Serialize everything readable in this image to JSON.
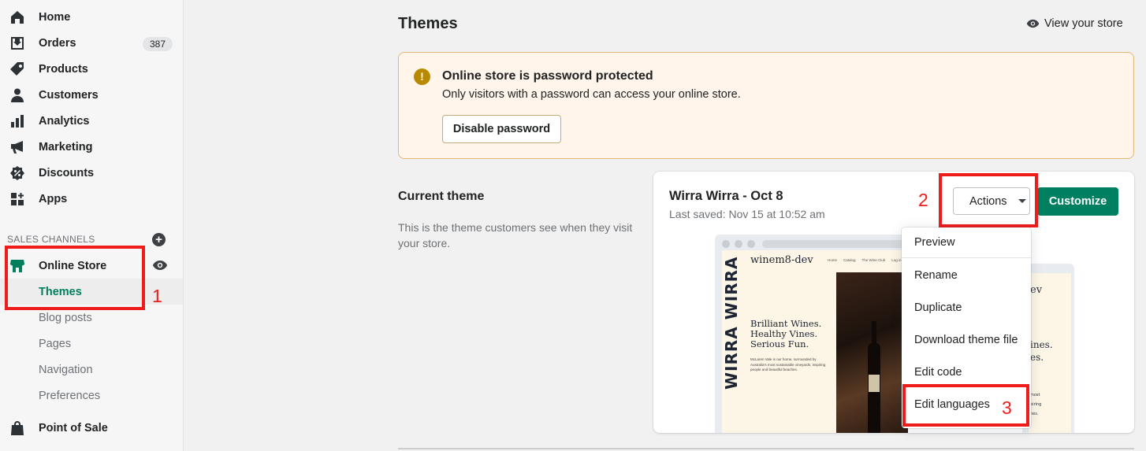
{
  "sidebar": {
    "nav": [
      {
        "label": "Home",
        "icon": "home-icon"
      },
      {
        "label": "Orders",
        "icon": "orders-icon",
        "badge": "387"
      },
      {
        "label": "Products",
        "icon": "tag-icon"
      },
      {
        "label": "Customers",
        "icon": "person-icon"
      },
      {
        "label": "Analytics",
        "icon": "bar-chart-icon"
      },
      {
        "label": "Marketing",
        "icon": "megaphone-icon"
      },
      {
        "label": "Discounts",
        "icon": "discount-icon"
      },
      {
        "label": "Apps",
        "icon": "apps-icon"
      }
    ],
    "sales_channels_heading": "SALES CHANNELS",
    "online_store": {
      "label": "Online Store",
      "sub_items": [
        {
          "label": "Themes",
          "active": true
        },
        {
          "label": "Blog posts"
        },
        {
          "label": "Pages"
        },
        {
          "label": "Navigation"
        },
        {
          "label": "Preferences"
        }
      ]
    },
    "point_of_sale": {
      "label": "Point of Sale"
    }
  },
  "header": {
    "title": "Themes",
    "view_store_label": "View your store"
  },
  "banner": {
    "title": "Online store is password protected",
    "text": "Only visitors with a password can access your online store.",
    "button_label": "Disable password",
    "icon": "!"
  },
  "current_theme": {
    "heading": "Current theme",
    "description": "This is the theme customers see when they visit your store.",
    "theme_name": "Wirra Wirra - Oct 8",
    "last_saved": "Last saved: Nov 15 at 10:52 am",
    "actions_label": "Actions",
    "customize_label": "Customize",
    "preview": {
      "brand": "WIRRA WIRRA",
      "store_name": "winem8-dev",
      "nav": [
        "Home",
        "Catalog",
        "The Wine Club",
        "Log in"
      ],
      "headline": "Brilliant Wines. Healthy Vines. Serious Fun.",
      "body": "McLaren Vale is our home, surrounded by Australia's most sustainable vineyards, inspiring people and beautiful beaches.",
      "back_partial": [
        "ev",
        "ines.",
        "es.",
        "most",
        "piring",
        "hes."
      ]
    }
  },
  "actions_menu": {
    "items": [
      "Preview",
      "Rename",
      "Duplicate",
      "Download theme file",
      "Edit code",
      "Edit languages"
    ]
  },
  "annotations": {
    "labels": [
      "1",
      "2",
      "3"
    ],
    "color": "#ef1c1c"
  },
  "colors": {
    "accent": "#008060",
    "active_nav": "#007f5f",
    "banner_bg": "#fff5ea",
    "warning_icon": "#b98900"
  }
}
